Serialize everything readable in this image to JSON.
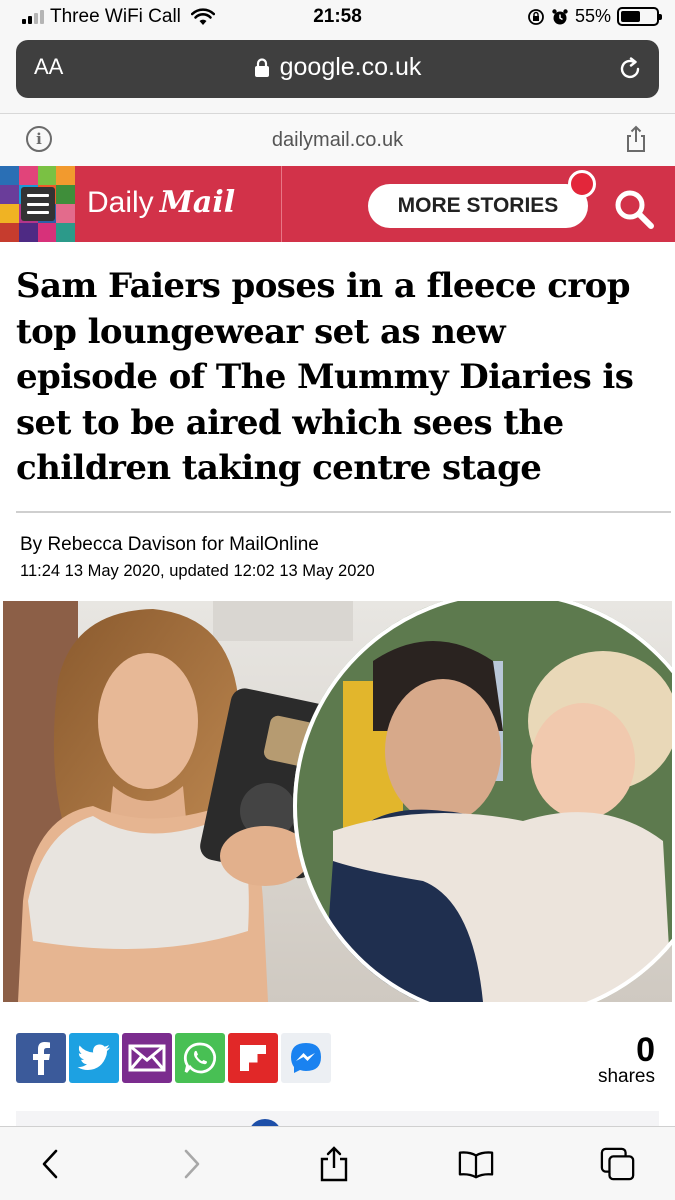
{
  "status_bar": {
    "carrier": "Three WiFi Call",
    "time": "21:58",
    "battery_text": "55%",
    "battery_level": 0.55
  },
  "url_bar": {
    "aa_label": "AA",
    "url": "google.co.uk"
  },
  "site_bar": {
    "domain": "dailymail.co.uk"
  },
  "header": {
    "brand_daily": "Daily",
    "brand_mail": "Mail",
    "more_stories": "MORE STORIES",
    "accent": "#d23249"
  },
  "article": {
    "headline": "Sam Faiers poses in a fleece crop top loungewear set as new episode of The Mummy Diaries is set to be aired which sees the children taking centre stage",
    "byline": "By Rebecca Davison for MailOnline",
    "dateline": "11:24 13 May 2020, updated 12:02 13 May 2020"
  },
  "share": {
    "count": "0",
    "label": "shares",
    "buttons": [
      "facebook-icon",
      "twitter-icon",
      "email-icon",
      "whatsapp-icon",
      "flipboard-icon",
      "messenger-icon"
    ]
  },
  "toolbar": {
    "icons": [
      "back-icon",
      "forward-icon",
      "share-icon",
      "bookmarks-icon",
      "tabs-icon"
    ]
  }
}
